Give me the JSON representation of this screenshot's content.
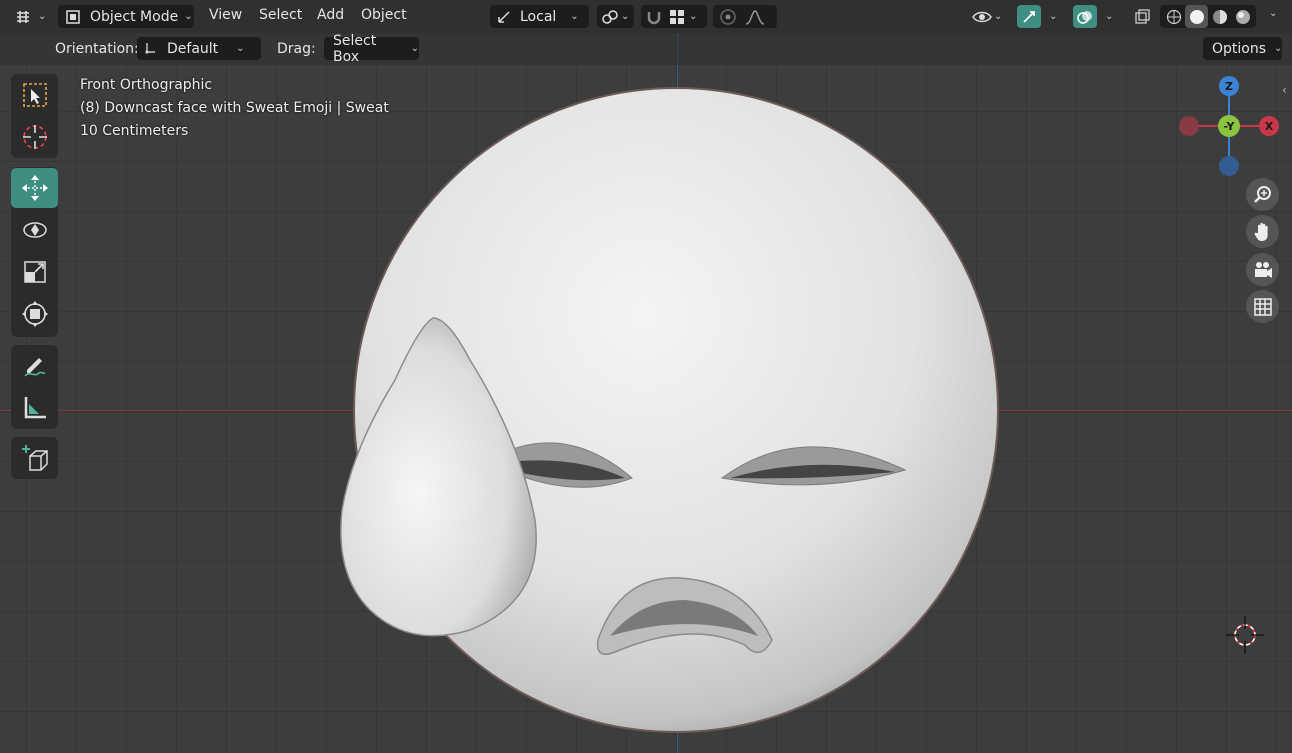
{
  "header": {
    "mode_label": "Object Mode",
    "menus": [
      "View",
      "Select",
      "Add",
      "Object"
    ],
    "transform_pivot_label": "Local",
    "options_label": "Options"
  },
  "tool_settings": {
    "orientation_label": "Orientation:",
    "orientation_value": "Default",
    "drag_label": "Drag:",
    "drag_value": "Select Box"
  },
  "overlay": {
    "view_name": "Front Orthographic",
    "object_info": "(8) Downcast face with Sweat Emoji | Sweat",
    "scale": "10 Centimeters"
  },
  "gizmo": {
    "z_label": "Z",
    "y_label": "-Y",
    "x_label": "X"
  },
  "colors": {
    "active_tool": "#3e8f82",
    "x_axis": "#c8384a",
    "y_axis": "#8bc53f",
    "z_axis": "#3c82d6"
  },
  "toolbar": {
    "tools": [
      "select-box",
      "cursor",
      "move",
      "rotate",
      "scale",
      "transform",
      "annotate",
      "measure",
      "add-cube"
    ],
    "active_tool": "move"
  }
}
